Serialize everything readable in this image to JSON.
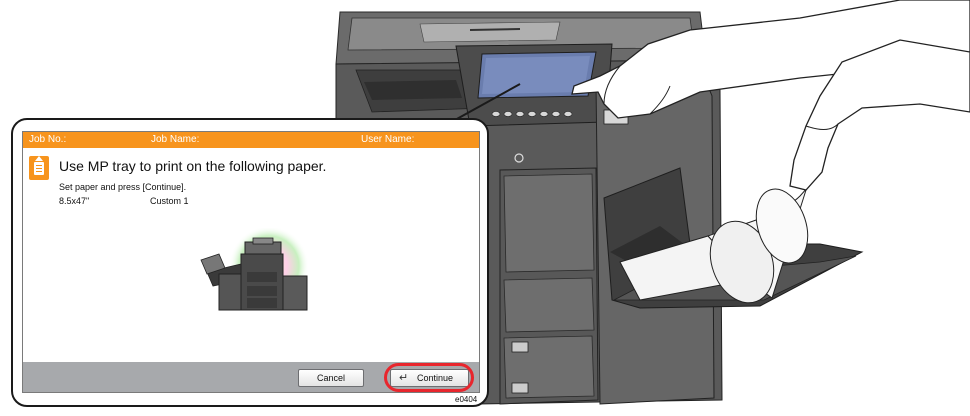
{
  "header": {
    "job_no": "Job No.:",
    "job_name": "Job Name:",
    "user_name": "User Name:"
  },
  "message": {
    "title": "Use MP tray to print on the following paper.",
    "instruction": "Set paper and press [Continue].",
    "paper_size": "8.5x47\"",
    "paper_type": "Custom 1"
  },
  "buttons": {
    "cancel": "Cancel",
    "continue": "Continue"
  },
  "figure_code": "e0404",
  "colors": {
    "header": "#f7941d",
    "footer": "#a7a9ac",
    "highlight": "#e8262d"
  }
}
